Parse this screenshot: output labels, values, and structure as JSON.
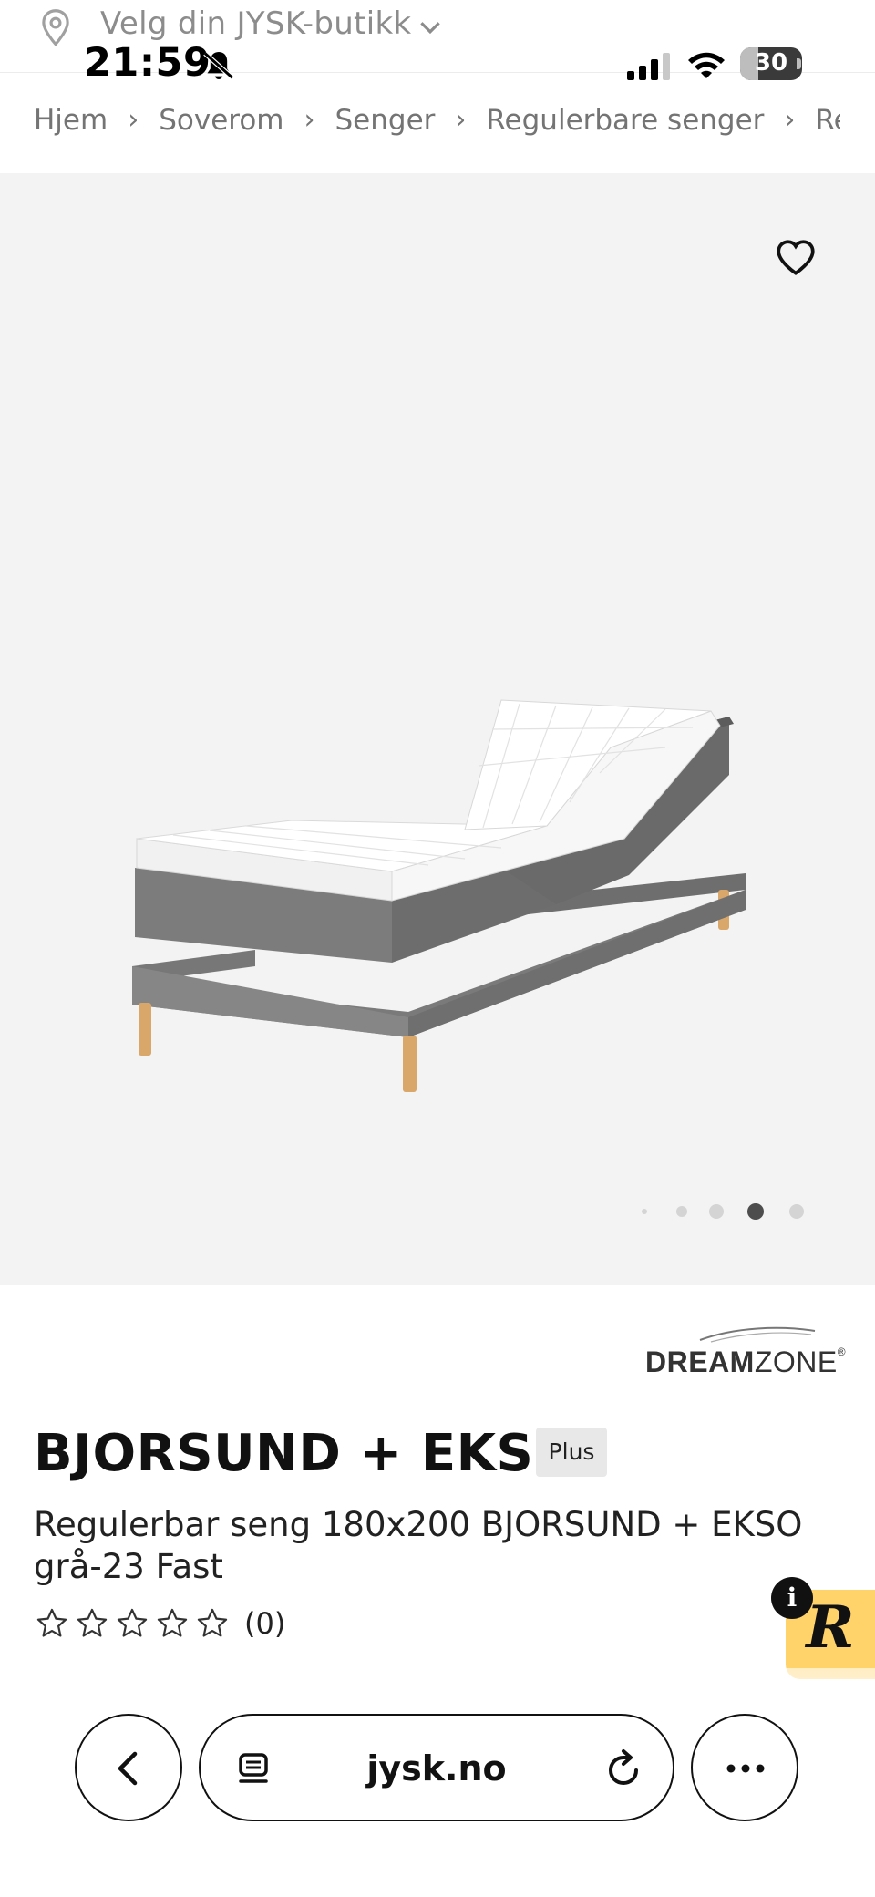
{
  "store_picker": {
    "label": "Velg din JYSK-butikk",
    "pin_icon": "location-pin-icon",
    "chevron_icon": "chevron-down-icon"
  },
  "status_bar": {
    "time": "21:59",
    "battery": "30",
    "battery_level": 0.3
  },
  "breadcrumb": [
    "Hjem",
    "Soverom",
    "Senger",
    "Regulerbare senger",
    "Regulerbare"
  ],
  "breadcrumb_separator": "›",
  "product": {
    "brand_bold": "DREAM",
    "brand_light": "ZONE",
    "brand_mark": "®",
    "name": "BJORSUND + EKSO",
    "badge": "Plus",
    "description": "Regulerbar seng 180x200 BJORSUND + EKSO grå-23 Fast",
    "rating_stars": 5,
    "rating_value": 0,
    "rating_count": "(0)"
  },
  "gallery": {
    "total": 5,
    "active_index": 3
  },
  "widget": {
    "info_label": "i",
    "letter": "R"
  },
  "browser": {
    "url": "jysk.no"
  },
  "colors": {
    "hero_bg": "#f3f3f3",
    "widget_yellow": "#ffd36a",
    "text_gray": "#747474"
  }
}
